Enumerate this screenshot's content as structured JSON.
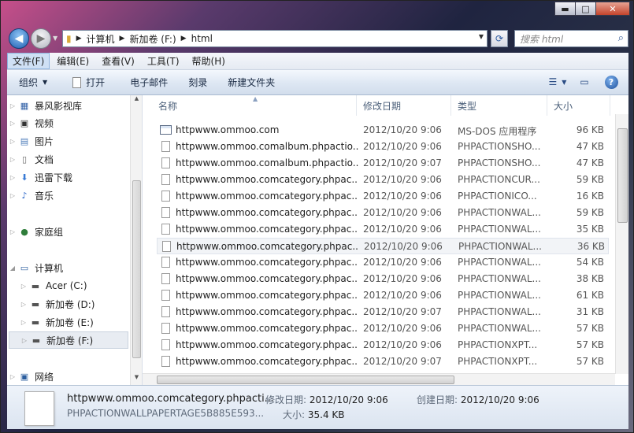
{
  "window": {
    "minimize": "▬",
    "maximize": "□",
    "close": "✕"
  },
  "address": {
    "parts": [
      "计算机",
      "新加卷 (F:)",
      "html"
    ],
    "search_placeholder": "搜索 html"
  },
  "menu": [
    "文件(F)",
    "编辑(E)",
    "查看(V)",
    "工具(T)",
    "帮助(H)"
  ],
  "toolbar": {
    "organize": "组织",
    "open": "打开",
    "email": "电子邮件",
    "burn": "刻录",
    "new_folder": "新建文件夹"
  },
  "sidebar": {
    "items": [
      {
        "label": "暴风影视库",
        "icon": "video-library-icon"
      },
      {
        "label": "视频",
        "icon": "video-icon"
      },
      {
        "label": "图片",
        "icon": "picture-icon"
      },
      {
        "label": "文档",
        "icon": "document-icon"
      },
      {
        "label": "迅雷下载",
        "icon": "download-icon"
      },
      {
        "label": "音乐",
        "icon": "music-icon"
      },
      {
        "label": "家庭组",
        "icon": "homegroup-icon"
      },
      {
        "label": "计算机",
        "icon": "computer-icon"
      },
      {
        "label": "Acer (C:)",
        "icon": "drive-icon"
      },
      {
        "label": "新加卷 (D:)",
        "icon": "drive-icon"
      },
      {
        "label": "新加卷 (E:)",
        "icon": "drive-icon"
      },
      {
        "label": "新加卷 (F:)",
        "icon": "drive-icon"
      },
      {
        "label": "网络",
        "icon": "network-icon"
      }
    ]
  },
  "columns": {
    "name": "名称",
    "date": "修改日期",
    "type": "类型",
    "size": "大小"
  },
  "files": [
    {
      "name": "httpwww.ommoo.com",
      "date": "2012/10/20 9:06",
      "type": "MS-DOS 应用程序",
      "size": "96 KB"
    },
    {
      "name": "httpwww.ommoo.comalbum.phpactio...",
      "date": "2012/10/20 9:06",
      "type": "PHPACTIONSHO...",
      "size": "47 KB"
    },
    {
      "name": "httpwww.ommoo.comalbum.phpactio...",
      "date": "2012/10/20 9:07",
      "type": "PHPACTIONSHO...",
      "size": "47 KB"
    },
    {
      "name": "httpwww.ommoo.comcategory.phpac...",
      "date": "2012/10/20 9:06",
      "type": "PHPACTIONCUR...",
      "size": "59 KB"
    },
    {
      "name": "httpwww.ommoo.comcategory.phpac...",
      "date": "2012/10/20 9:06",
      "type": "PHPACTIONICO...",
      "size": "16 KB"
    },
    {
      "name": "httpwww.ommoo.comcategory.phpac...",
      "date": "2012/10/20 9:06",
      "type": "PHPACTIONWAL...",
      "size": "59 KB"
    },
    {
      "name": "httpwww.ommoo.comcategory.phpac...",
      "date": "2012/10/20 9:06",
      "type": "PHPACTIONWAL...",
      "size": "35 KB"
    },
    {
      "name": "httpwww.ommoo.comcategory.phpac...",
      "date": "2012/10/20 9:06",
      "type": "PHPACTIONWAL...",
      "size": "36 KB"
    },
    {
      "name": "httpwww.ommoo.comcategory.phpac...",
      "date": "2012/10/20 9:06",
      "type": "PHPACTIONWAL...",
      "size": "54 KB"
    },
    {
      "name": "httpwww.ommoo.comcategory.phpac...",
      "date": "2012/10/20 9:06",
      "type": "PHPACTIONWAL...",
      "size": "38 KB"
    },
    {
      "name": "httpwww.ommoo.comcategory.phpac...",
      "date": "2012/10/20 9:06",
      "type": "PHPACTIONWAL...",
      "size": "61 KB"
    },
    {
      "name": "httpwww.ommoo.comcategory.phpac...",
      "date": "2012/10/20 9:07",
      "type": "PHPACTIONWAL...",
      "size": "31 KB"
    },
    {
      "name": "httpwww.ommoo.comcategory.phpac...",
      "date": "2012/10/20 9:06",
      "type": "PHPACTIONWAL...",
      "size": "57 KB"
    },
    {
      "name": "httpwww.ommoo.comcategory.phpac...",
      "date": "2012/10/20 9:06",
      "type": "PHPACTIONXPT...",
      "size": "57 KB"
    },
    {
      "name": "httpwww.ommoo.comcategory.phpac...",
      "date": "2012/10/20 9:07",
      "type": "PHPACTIONXPT...",
      "size": "57 KB"
    }
  ],
  "details": {
    "name": "httpwww.ommoo.comcategory.phpacti...",
    "type": "PHPACTIONWALLPAPERTAGE5B885E593...",
    "modified_label": "修改日期:",
    "modified": "2012/10/20 9:06",
    "created_label": "创建日期:",
    "created": "2012/10/20 9:06",
    "size_label": "大小:",
    "size": "35.4 KB"
  }
}
